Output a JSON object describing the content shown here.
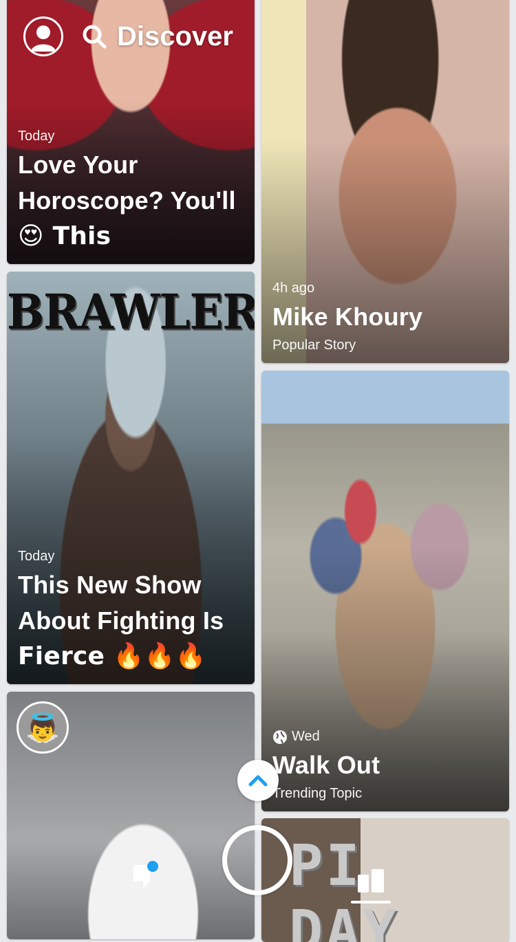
{
  "header": {
    "title": "Discover",
    "profile_icon": "profile-icon",
    "search_icon": "search-icon"
  },
  "cards": [
    {
      "time": "Today",
      "title_lines": [
        "Love Your",
        "Horoscope? You'll",
        "😍 This"
      ]
    },
    {
      "time": "4h ago",
      "title": "Mike Khoury",
      "subtitle": "Popular Story"
    },
    {
      "logo_text": "BRAWLER",
      "time": "Today",
      "title_lines": [
        "This New Show",
        "About Fighting Is",
        "Fierce 🔥🔥🔥"
      ]
    },
    {
      "time": "Wed",
      "title": "Walk Out",
      "subtitle": "Trending Topic",
      "time_icon": "globe-icon"
    },
    {
      "avatar_emoji": "👼"
    },
    {
      "logo_text": "PI DAY"
    }
  ],
  "nav": {
    "up_icon": "chevron-up-icon",
    "capture_icon": "capture-ring-icon",
    "chat_icon": "chat-icon",
    "stories_icon": "stories-icon",
    "notification_color": "#1e9ff2",
    "chevron_color": "#1e9ff2"
  }
}
